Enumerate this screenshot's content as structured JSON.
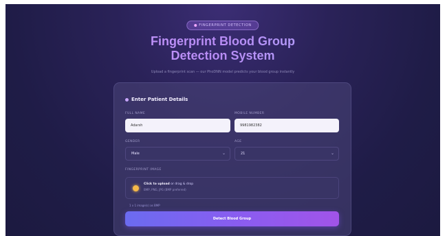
{
  "badge": {
    "label": "FINGERPRINT DETECTION"
  },
  "header": {
    "title_line1": "Fingerprint Blood Group",
    "title_line2": "Detection System",
    "subtitle": "Upload a fingerprint scan — our PhoDNN model predicts your blood group instantly"
  },
  "form": {
    "section_title": "Enter Patient Details",
    "full_name": {
      "label": "FULL NAME",
      "value": "Adarsh"
    },
    "mobile": {
      "label": "MOBILE NUMBER",
      "value": "9981982382"
    },
    "gender": {
      "label": "GENDER",
      "value": "Male"
    },
    "age": {
      "label": "AGE",
      "value": "21"
    },
    "fingerprint": {
      "label": "FINGERPRINT IMAGE",
      "upload_action": "Click to upload",
      "upload_rest": "or drag & drop",
      "formats": "BMP, PNG, JPG (BMP preferred)"
    },
    "hint": "1 x 1 image(s) as BMP",
    "submit_label": "Detect Blood Group"
  },
  "colors": {
    "accent": "#8b5cf0",
    "background": "#1f1c47",
    "upload_icon": "#f5b94a"
  }
}
